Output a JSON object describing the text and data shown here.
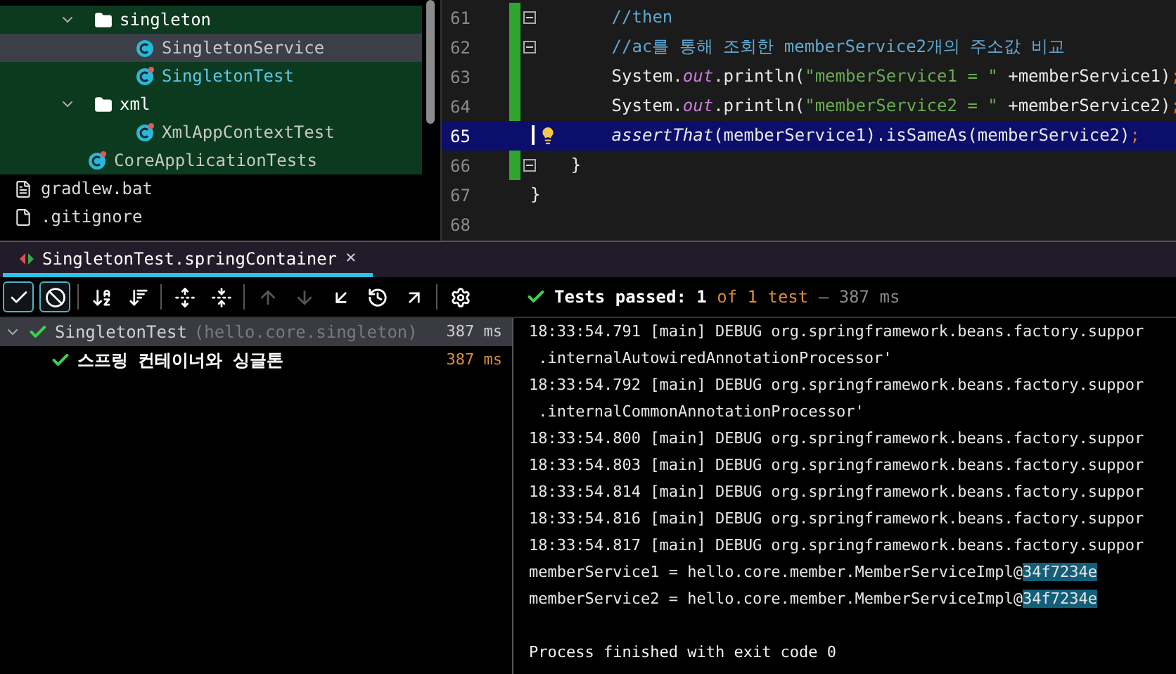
{
  "project_tree": [
    {
      "label": "singleton",
      "kind": "package",
      "expanded": true,
      "selected": false,
      "current": false,
      "children": [
        {
          "label": "SingletonService",
          "kind": "class",
          "selected": true,
          "current": false
        },
        {
          "label": "SingletonTest",
          "kind": "test-class",
          "selected": false,
          "current": true
        }
      ]
    },
    {
      "label": "xml",
      "kind": "package",
      "expanded": true,
      "selected": false,
      "current": false,
      "children": [
        {
          "label": "XmlAppContextTest",
          "kind": "test-class",
          "selected": false,
          "current": false
        }
      ]
    },
    {
      "label": "CoreApplicationTests",
      "kind": "test-class",
      "selected": false,
      "current": false
    }
  ],
  "root_files": [
    {
      "label": "gradlew.bat",
      "kind": "text-file"
    },
    {
      "label": ".gitignore",
      "kind": "ignore-file"
    }
  ],
  "editor": {
    "lines": [
      {
        "number": "61",
        "current": false,
        "fold": true,
        "tokens": [
          {
            "text": "        //then",
            "kind": "comment"
          }
        ]
      },
      {
        "number": "62",
        "current": false,
        "fold": true,
        "tokens": [
          {
            "text": "        //ac를 통해 조회한 memberService2개의 주소값 비교",
            "kind": "comment"
          }
        ]
      },
      {
        "number": "63",
        "current": false,
        "fold": false,
        "tokens": [
          {
            "text": "        System.",
            "kind": "plain"
          },
          {
            "text": "out",
            "kind": "field"
          },
          {
            "text": ".println(",
            "kind": "plain"
          },
          {
            "text": "\"memberService1 = \"",
            "kind": "string"
          },
          {
            "text": " +memberService1)",
            "kind": "plain"
          },
          {
            "text": ";",
            "kind": "punct"
          }
        ]
      },
      {
        "number": "64",
        "current": false,
        "fold": false,
        "tokens": [
          {
            "text": "        System.",
            "kind": "plain"
          },
          {
            "text": "out",
            "kind": "field"
          },
          {
            "text": ".println(",
            "kind": "plain"
          },
          {
            "text": "\"memberService2 = \"",
            "kind": "string"
          },
          {
            "text": " +memberService2)",
            "kind": "plain"
          },
          {
            "text": ";",
            "kind": "punct"
          }
        ]
      },
      {
        "number": "65",
        "current": true,
        "fold": false,
        "tokens": [
          {
            "text": "        assertThat",
            "kind": "static"
          },
          {
            "text": "(memberService1).isSameAs(memberService2)",
            "kind": "plain"
          },
          {
            "text": ";",
            "kind": "punct"
          }
        ]
      },
      {
        "number": "66",
        "current": false,
        "fold": true,
        "tokens": [
          {
            "text": "    }",
            "kind": "plain"
          }
        ]
      },
      {
        "number": "67",
        "current": false,
        "fold": false,
        "tokens": [
          {
            "text": "}",
            "kind": "plain"
          }
        ]
      },
      {
        "number": "68",
        "current": false,
        "fold": false
      }
    ]
  },
  "run_tab": {
    "label": "SingletonTest.springContainer",
    "close": "×"
  },
  "toolbar": [
    {
      "kind": "check",
      "selected": true,
      "disabled": false
    },
    {
      "kind": "ban",
      "selected": true,
      "disabled": false
    },
    {
      "kind": "sort-alpha",
      "selected": false,
      "disabled": false
    },
    {
      "kind": "sort-duration",
      "selected": false,
      "disabled": false
    },
    {
      "kind": "expand",
      "selected": false,
      "disabled": false
    },
    {
      "kind": "collapse",
      "selected": false,
      "disabled": false
    },
    {
      "kind": "up",
      "selected": false,
      "disabled": true
    },
    {
      "kind": "down",
      "selected": false,
      "disabled": true
    },
    {
      "kind": "import",
      "selected": false,
      "disabled": false
    },
    {
      "kind": "history",
      "selected": false,
      "disabled": false
    },
    {
      "kind": "export",
      "selected": false,
      "disabled": false
    },
    {
      "kind": "settings",
      "selected": false,
      "disabled": false
    }
  ],
  "status": {
    "passed": "Tests passed: 1",
    "count": "of 1 test",
    "time": "– 387 ms"
  },
  "test_tree": [
    {
      "label": "SingletonTest",
      "detail": "(hello.core.singleton)",
      "time": "387 ms",
      "passed": true,
      "expanded": true,
      "selected": true,
      "children": [
        {
          "label": "스프링 컨테이너와 싱글톤",
          "time": "387 ms",
          "passed": true,
          "selected": false
        }
      ]
    }
  ],
  "console": [
    {
      "kind": "log",
      "segments": [
        {
          "text": "18:33:54.791 [main] DEBUG org.springframework.beans.factory.suppor",
          "highlighted": false
        }
      ]
    },
    {
      "kind": "log",
      "segments": [
        {
          "text": " .internalAutowiredAnnotationProcessor'",
          "highlighted": false
        }
      ]
    },
    {
      "kind": "log",
      "segments": [
        {
          "text": "18:33:54.792 [main] DEBUG org.springframework.beans.factory.suppor",
          "highlighted": false
        }
      ]
    },
    {
      "kind": "log",
      "segments": [
        {
          "text": " .internalCommonAnnotationProcessor'",
          "highlighted": false
        }
      ]
    },
    {
      "kind": "log",
      "segments": [
        {
          "text": "18:33:54.800 [main] DEBUG org.springframework.beans.factory.suppor",
          "highlighted": false
        }
      ]
    },
    {
      "kind": "log",
      "segments": [
        {
          "text": "18:33:54.803 [main] DEBUG org.springframework.beans.factory.suppor",
          "highlighted": false
        }
      ]
    },
    {
      "kind": "log",
      "segments": [
        {
          "text": "18:33:54.814 [main] DEBUG org.springframework.beans.factory.suppor",
          "highlighted": false
        }
      ]
    },
    {
      "kind": "log",
      "segments": [
        {
          "text": "18:33:54.816 [main] DEBUG org.springframework.beans.factory.suppor",
          "highlighted": false
        }
      ]
    },
    {
      "kind": "log",
      "segments": [
        {
          "text": "18:33:54.817 [main] DEBUG org.springframework.beans.factory.suppor",
          "highlighted": false
        }
      ]
    },
    {
      "kind": "log",
      "segments": [
        {
          "text": "memberService1 = hello.core.member.MemberServiceImpl@",
          "highlighted": false
        },
        {
          "text": "34f7234e",
          "highlighted": true
        }
      ]
    },
    {
      "kind": "log",
      "segments": [
        {
          "text": "memberService2 = hello.core.member.MemberServiceImpl@",
          "highlighted": false
        },
        {
          "text": "34f7234e",
          "highlighted": true
        }
      ]
    },
    {
      "kind": "exit",
      "segments": [
        {
          "text": "Process finished with exit code 0",
          "highlighted": false
        }
      ]
    }
  ]
}
